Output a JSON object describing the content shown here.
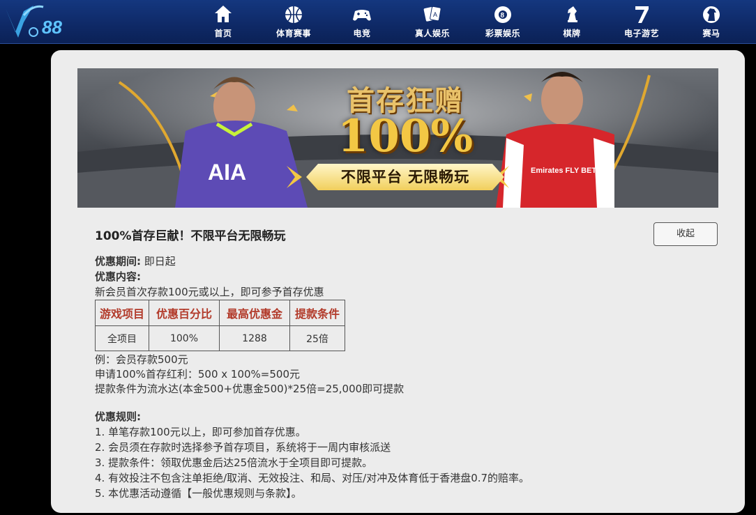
{
  "header": {
    "logo_text": "88",
    "nav": [
      {
        "label": "首页",
        "icon": "home-icon"
      },
      {
        "label": "体育赛事",
        "icon": "basketball-icon"
      },
      {
        "label": "电竞",
        "icon": "gamepad-icon"
      },
      {
        "label": "真人娱乐",
        "icon": "cards-icon"
      },
      {
        "label": "彩票娱乐",
        "icon": "eight-ball-icon"
      },
      {
        "label": "棋牌",
        "icon": "chess-knight-icon"
      },
      {
        "label": "电子游艺",
        "icon": "seven-icon"
      },
      {
        "label": "赛马",
        "icon": "horse-icon"
      }
    ]
  },
  "banner": {
    "title": "首存狂赠",
    "percent": "100%",
    "slogan": "不限平台  无限畅玩",
    "jersey_left": "AIA",
    "jersey_right": "Emirates FLY BETTER"
  },
  "promo": {
    "title": "100%首存巨献！不限平台无限畅玩",
    "collapse_label": "收起",
    "period_label": "优惠期间:",
    "period_value": " 即日起",
    "content_label": "优惠内容:",
    "content_text": "新会员首次存款100元或以上，即可参予首存优惠",
    "table": {
      "headers": [
        "游戏项目",
        "优惠百分比",
        "最高优惠金",
        "提款条件"
      ],
      "row": [
        "全项目",
        "100%",
        "1288",
        "25倍"
      ]
    },
    "example": [
      "例：会员存款500元",
      "申请100%首存红利：500 x 100%=500元",
      "提款条件为流水达(本金500+优惠金500)*25倍=25,000即可提款"
    ],
    "rules_label": "优惠规则:",
    "rules": [
      "1. 单笔存款100元以上，即可参加首存优惠。",
      "2. 会员须在存款时选择参予首存项目，系统将于一周内审核派送",
      "3. 提款条件：领取优惠金后达25倍流水于全项目即可提款。",
      "4. 有效投注不包含注单拒绝/取消、无效投注、和局、对压/对冲及体育低于香港盘0.7的赔率。",
      "5. 本优惠活动遵循【一般优惠规则与条款】。"
    ]
  },
  "colors": {
    "header_bg": "#0f2a68",
    "card_bg": "#ececec",
    "table_header_text": "#b23a2a",
    "banner_gold": "#f3c744"
  }
}
